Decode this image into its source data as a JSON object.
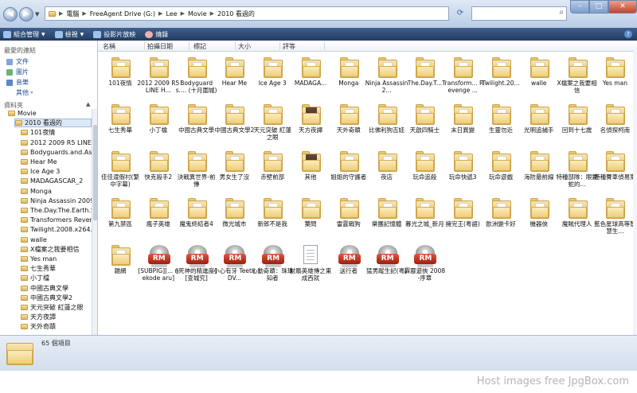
{
  "address": {
    "crumbs": [
      "電腦",
      "FreeAgent Drive (G:)",
      "Lee",
      "Movie",
      "2010 看過的"
    ]
  },
  "toolbar": {
    "organize": "組合管理",
    "views": "檢視",
    "slideshow": "投影片放映",
    "burn": "燒錄"
  },
  "nav": {
    "favorites_header": "最愛的連結",
    "favorites": [
      "文件",
      "圖片",
      "音樂"
    ],
    "more": "其他",
    "folders_header": "資料夾",
    "tree": [
      "Movie",
      "2010 看過的",
      "101夜情",
      "2012 2009 R5 LINE H",
      "Bodyguards.and.Assa",
      "Hear Me",
      "Ice Age 3",
      "MADAGASCAR_2",
      "Monga",
      "Ninja Assassin 2009 R",
      "The.Day.The.Earth.St",
      "Transformers Reveng",
      "Twilight.2008.x264.7",
      "walle",
      "X檔案之我要相信",
      "Yes man",
      "七生秀華",
      "小丁檔",
      "中國古典文學",
      "中國古典文學2",
      "天元突破 紅蓮之眼",
      "天方夜譚",
      "天外奇蹟"
    ]
  },
  "columns": [
    "名稱",
    "拍攝日期",
    "標記",
    "大小",
    "評等"
  ],
  "items": [
    {
      "label": "101夜情",
      "type": "folder"
    },
    {
      "label": "2012 2009 R5 LINE H...",
      "type": "folder"
    },
    {
      "label": "Bodyguards.... (十月圍城)",
      "type": "folder"
    },
    {
      "label": "Hear Me",
      "type": "folder"
    },
    {
      "label": "Ice Age 3",
      "type": "folder"
    },
    {
      "label": "MADAGA...",
      "type": "folder"
    },
    {
      "label": "Monga",
      "type": "folder"
    },
    {
      "label": "Ninja Assassin 2...",
      "type": "folder"
    },
    {
      "label": "The.Day.T...",
      "type": "folder"
    },
    {
      "label": "Transform... Revenge ...",
      "type": "folder"
    },
    {
      "label": "Twilight.20...",
      "type": "folder"
    },
    {
      "label": "walle",
      "type": "folder"
    },
    {
      "label": "X檔案之我要相信",
      "type": "folder"
    },
    {
      "label": "Yes man",
      "type": "folder"
    },
    {
      "label": "七生秀華",
      "type": "folder"
    },
    {
      "label": "小丁檔",
      "type": "folder"
    },
    {
      "label": "中國古典文學",
      "type": "folder"
    },
    {
      "label": "中國古典文學2",
      "type": "folder"
    },
    {
      "label": "天元突破 紅蓮之眼",
      "type": "folder"
    },
    {
      "label": "天方夜譚",
      "type": "folder-thumb"
    },
    {
      "label": "天外奇蹟",
      "type": "folder"
    },
    {
      "label": "比佛利狗吉娃",
      "type": "folder"
    },
    {
      "label": "天啟四騎士",
      "type": "folder"
    },
    {
      "label": "末日異變",
      "type": "folder"
    },
    {
      "label": "生靈勿近",
      "type": "folder"
    },
    {
      "label": "光明追捕手",
      "type": "folder"
    },
    {
      "label": "回到十七歲",
      "type": "folder"
    },
    {
      "label": "名偵探柯南",
      "type": "folder"
    },
    {
      "label": "佳佳渡假村(繁中字幕)",
      "type": "folder"
    },
    {
      "label": "快克殺手2",
      "type": "folder"
    },
    {
      "label": "決戰異世界-前傳",
      "type": "folder"
    },
    {
      "label": "男女生了沒",
      "type": "folder"
    },
    {
      "label": "赤壁前部",
      "type": "folder"
    },
    {
      "label": "其他",
      "type": "folder-thumb"
    },
    {
      "label": "姐姐的守護者",
      "type": "folder"
    },
    {
      "label": "夜店",
      "type": "folder"
    },
    {
      "label": "玩命追殺",
      "type": "folder"
    },
    {
      "label": "玩命快遞3",
      "type": "folder"
    },
    {
      "label": "玩命遊戲",
      "type": "folder"
    },
    {
      "label": "海防最前線",
      "type": "folder"
    },
    {
      "label": "特種部隊：眼鏡蛇的...",
      "type": "folder"
    },
    {
      "label": "特種賽車偵易案",
      "type": "folder"
    },
    {
      "label": "第九禁區",
      "type": "folder"
    },
    {
      "label": "瘋子英雄",
      "type": "folder"
    },
    {
      "label": "魔鬼終結者4",
      "type": "folder"
    },
    {
      "label": "微光城市",
      "type": "folder"
    },
    {
      "label": "新郎不是我",
      "type": "folder"
    },
    {
      "label": "葉問",
      "type": "folder"
    },
    {
      "label": "雷霆戰狗",
      "type": "folder"
    },
    {
      "label": "樂團記憶體",
      "type": "folder"
    },
    {
      "label": "暮光之城_新月",
      "type": "folder"
    },
    {
      "label": "擁完王(粵語)",
      "type": "folder"
    },
    {
      "label": "歐洲變卡好",
      "type": "folder"
    },
    {
      "label": "機器俠",
      "type": "folder"
    },
    {
      "label": "魔賊代理人",
      "type": "folder"
    },
    {
      "label": "藍色星球高等智慧生...",
      "type": "folder"
    },
    {
      "label": "雜網",
      "type": "folder"
    },
    {
      "label": "[SUBPIG][... nekode aru]",
      "type": "rm"
    },
    {
      "label": "[死神的精進度][查城究]",
      "type": "rm"
    },
    {
      "label": "小心有牙 Teeth DV...",
      "type": "rm"
    },
    {
      "label": "心動奇蹟：珠珠知者",
      "type": "rm"
    },
    {
      "label": "射鵰英雄傳之東成西就",
      "type": "doc"
    },
    {
      "label": "送行者",
      "type": "rm"
    },
    {
      "label": "猛男蹤生記(粵)",
      "type": "rm"
    },
    {
      "label": "霹靂遊俠 2008-序章",
      "type": "rm"
    }
  ],
  "status": {
    "count": "65 個項目"
  },
  "watermark": "Host images free JpgBox.com"
}
